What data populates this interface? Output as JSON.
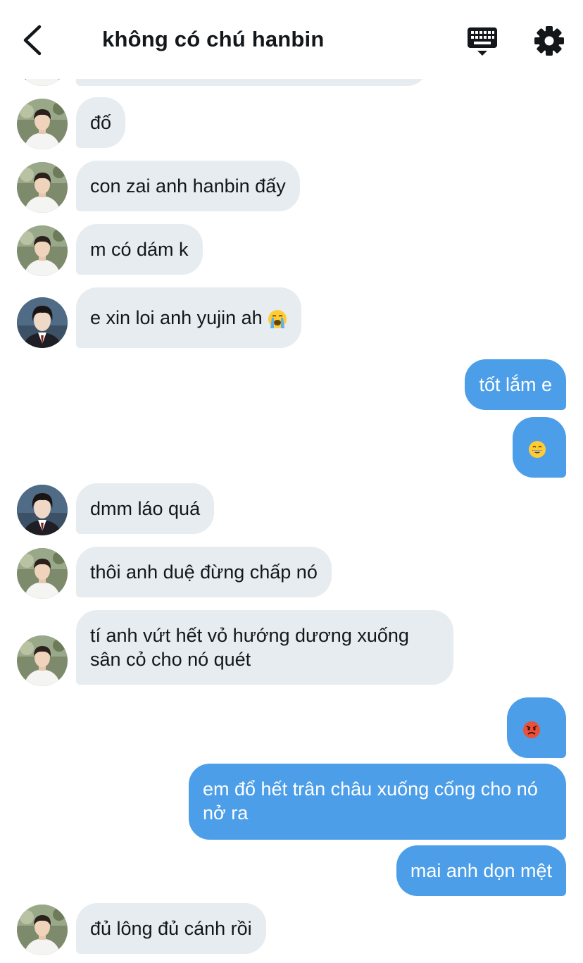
{
  "header": {
    "title": "không có chú hanbin",
    "back_icon": "chevron-left-icon",
    "keyboard_icon": "keyboard-icon",
    "settings_icon": "gear-icon"
  },
  "colors": {
    "incoming_bubble": "#e6ecf0",
    "outgoing_bubble": "#4c9ee8",
    "outgoing_text": "#ffffff",
    "incoming_text": "#14171a"
  },
  "messages": [
    {
      "side": "in",
      "avatar": "avatar-white-shirt",
      "text": "đố"
    },
    {
      "side": "in",
      "avatar": "avatar-white-shirt",
      "text": "con zai anh hanbin đấy"
    },
    {
      "side": "in",
      "avatar": "avatar-white-shirt",
      "text": "m có dám k"
    },
    {
      "side": "in",
      "avatar": "avatar-school-uniform",
      "text": "e xin loi anh yujin ah",
      "emoji": "loudly-crying-face-emoji"
    },
    {
      "side": "out",
      "text": "tốt lắm e"
    },
    {
      "side": "out",
      "emoji": "grinning-face-emoji"
    },
    {
      "side": "in",
      "avatar": "avatar-school-uniform",
      "text": "dmm láo quá"
    },
    {
      "side": "in",
      "avatar": "avatar-white-shirt",
      "text": "thôi anh duệ đừng chấp nó"
    },
    {
      "side": "in",
      "avatar": "avatar-white-shirt",
      "text": "tí anh vứt hết vỏ hướng dương xuống sân cỏ cho nó quét"
    },
    {
      "side": "out",
      "emoji": "angry-face-emoji"
    },
    {
      "side": "out",
      "text": "em đổ hết trân châu xuống cống cho nó nở ra"
    },
    {
      "side": "out",
      "text": "mai anh dọn mệt"
    },
    {
      "side": "in",
      "avatar": "avatar-white-shirt",
      "text": "đủ lông đủ cánh rồi"
    }
  ]
}
